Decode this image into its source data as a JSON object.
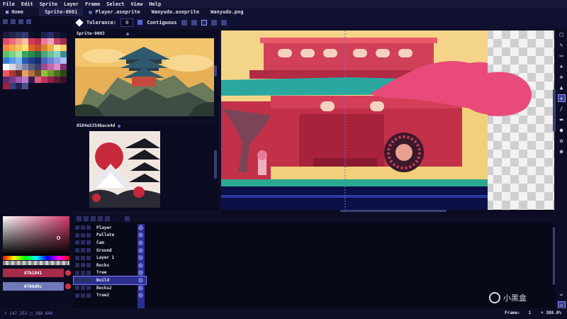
{
  "menu": [
    "File",
    "Edit",
    "Sprite",
    "Layer",
    "Frame",
    "Select",
    "View",
    "Help"
  ],
  "tabs": [
    {
      "label": "Home",
      "active": false
    },
    {
      "label": "Sprite-0001",
      "active": true
    },
    {
      "label": "Player.aseprite",
      "active": false
    },
    {
      "label": "Wanyudo.aseprite",
      "active": false
    },
    {
      "label": "Wanyudo.png",
      "active": false
    }
  ],
  "toolbar": {
    "tolerance_label": "Tolerance:",
    "tolerance_value": "0",
    "contiguous_label": "Contiguous"
  },
  "references": [
    {
      "title": "Sprite-0003"
    },
    {
      "title": "0584e5354bace4d"
    }
  ],
  "palette_colors": [
    "#1a1c3c",
    "#222548",
    "#2c2f5e",
    "#363a70",
    "#10122e",
    "#0c0d24",
    "#1f2250",
    "#2a2e6a",
    "#171936",
    "#0f1130",
    "#e24a6a",
    "#f06d7a",
    "#f59a8a",
    "#f7c3a0",
    "#d13a5a",
    "#b83050",
    "#e87a9a",
    "#f0a6b8",
    "#c24468",
    "#a02e4e",
    "#f28c3a",
    "#f5a64a",
    "#f8c45a",
    "#fbe07a",
    "#e0632c",
    "#c4522a",
    "#d9822e",
    "#f0b048",
    "#fde9a0",
    "#ffd06a",
    "#5ac26a",
    "#7fd48a",
    "#a0e6a6",
    "#3aa25a",
    "#2a8a4e",
    "#1e6e46",
    "#4aa87a",
    "#6ec09a",
    "#8ad4c0",
    "#3a9096",
    "#3a7ad6",
    "#5a9ae6",
    "#7ab8f0",
    "#2a5ab4",
    "#223c8e",
    "#1a2e6a",
    "#4a64c0",
    "#6a82d6",
    "#8aa0e8",
    "#b0c0f4",
    "#ffffff",
    "#d6d8e6",
    "#a8abc4",
    "#7e82a4",
    "#585c84",
    "#3c4066",
    "#a44a8a",
    "#c46aa8",
    "#e08ac6",
    "#7a3272",
    "#f05a5a",
    "#a83838",
    "#6a2a2a",
    "#e0a060",
    "#b07040",
    "#704a2a",
    "#90c040",
    "#6a9a2a",
    "#4a7020",
    "#2a4a18",
    "#5a2a6a",
    "#7a3a8a",
    "#9a5aaa",
    "#ba7aca",
    "#3a1a4a",
    "#e06080",
    "#c03060",
    "#902048",
    "#601a36",
    "#401028",
    "#a0203c",
    "#3a3e7c",
    "#20224c",
    "#4a4e8e"
  ],
  "colors": {
    "primary_hex": "#7b1841",
    "secondary_hex": "#706d9c"
  },
  "layers": [
    "Player",
    "Pallete",
    "Cam",
    "Ground",
    "Layer 1",
    "Rocks",
    "Tree",
    "Build",
    "Rocks2",
    "Tree2"
  ],
  "selected_layer": "Build",
  "frame_header": "1",
  "status": {
    "coords": "• 147 252  □ 388 640",
    "frame_label": "Frame:",
    "frame_value": "1",
    "zoom": "388.0%"
  },
  "watermark": "小黑盒"
}
